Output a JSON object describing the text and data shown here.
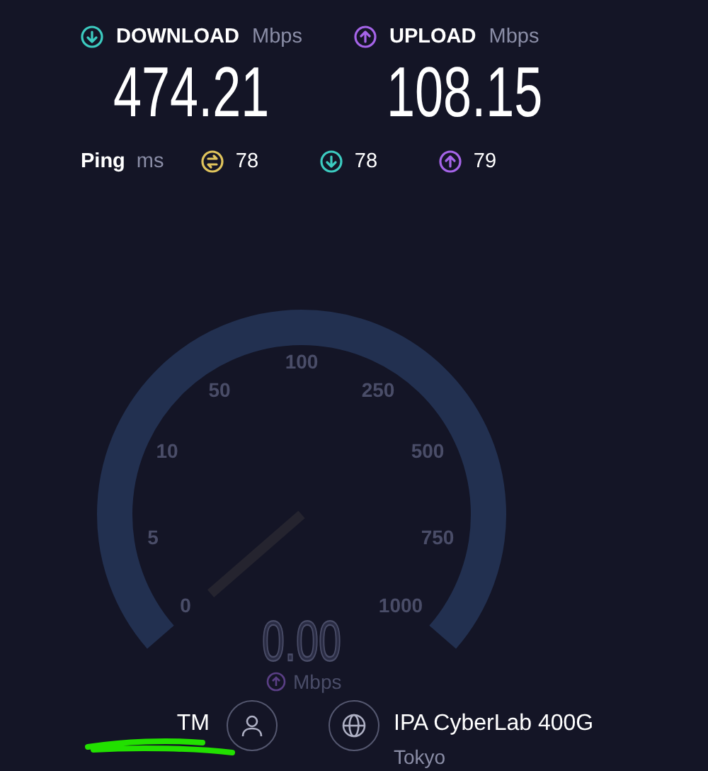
{
  "results": [
    {
      "kind": "download",
      "label": "DOWNLOAD",
      "unit": "Mbps",
      "value": "474.21",
      "color": "#3ccbc0"
    },
    {
      "kind": "upload",
      "label": "UPLOAD",
      "unit": "Mbps",
      "value": "108.15",
      "color": "#a564e8"
    }
  ],
  "ping": {
    "label": "Ping",
    "unit": "ms",
    "items": [
      {
        "kind": "idle",
        "value": "78",
        "color": "#e0c45c"
      },
      {
        "kind": "download",
        "value": "78",
        "color": "#3ccbc0"
      },
      {
        "kind": "upload",
        "value": "79",
        "color": "#a564e8"
      }
    ]
  },
  "gauge": {
    "labels": [
      "0",
      "5",
      "10",
      "50",
      "100",
      "250",
      "500",
      "750",
      "1000"
    ],
    "reading": "0.00",
    "unit": "Mbps"
  },
  "client": {
    "name": "TM"
  },
  "server": {
    "name": "IPA CyberLab 400G",
    "location": "Tokyo"
  }
}
